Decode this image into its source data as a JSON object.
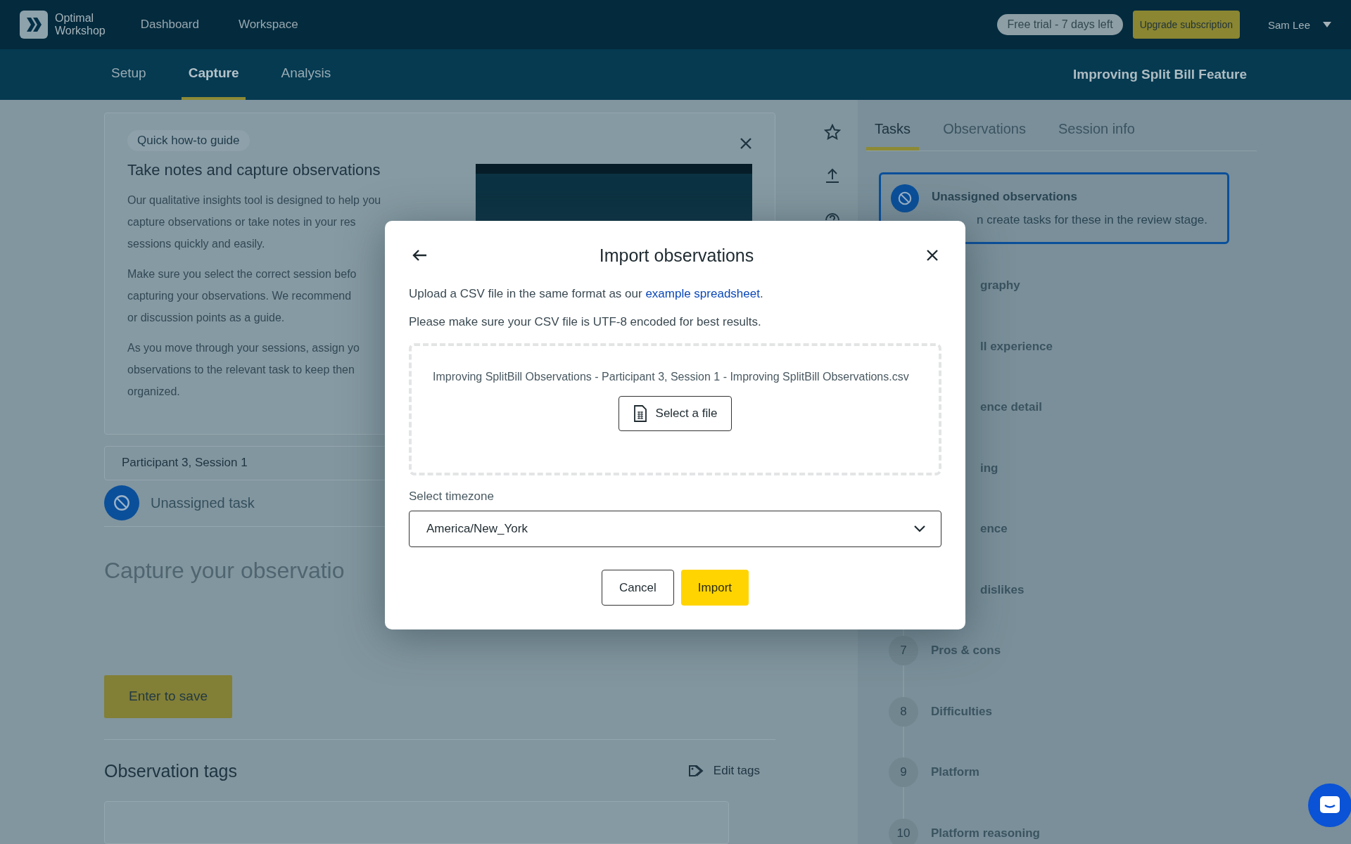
{
  "header": {
    "logo_lines": [
      "Optimal",
      "Workshop"
    ],
    "nav": [
      {
        "label": "Dashboard"
      },
      {
        "label": "Workspace"
      }
    ],
    "trial_badge": "Free trial - 7 days left",
    "upgrade_button": "Upgrade subscription",
    "user": "Sam Lee"
  },
  "subnav": {
    "tabs": [
      {
        "label": "Setup",
        "selected": false
      },
      {
        "label": "Capture",
        "selected": true
      },
      {
        "label": "Analysis",
        "selected": false
      }
    ],
    "study_title": "Improving Split Bill Feature"
  },
  "guide": {
    "badge": "Quick how-to guide",
    "title": "Take notes and capture observations",
    "paragraphs": [
      [
        "Our qualitative insights tool is designed to help you",
        "capture observations or take notes in your res",
        "sessions quickly and easily."
      ],
      [
        "Make sure you select the correct session befo",
        "capturing your observations. We recommend",
        "or discussion points as a guide."
      ],
      [
        "As you move through your sessions, assign yo",
        "observations to the relevant task to keep then",
        "organized."
      ]
    ]
  },
  "session_select": {
    "value": "Participant 3, Session 1"
  },
  "current_task": "Unassigned task",
  "observation_input": {
    "placeholder": "Capture your observatio"
  },
  "save_button": "Enter to save",
  "tags": {
    "title": "Observation tags",
    "edit_link": "Edit tags"
  },
  "side_tabs": [
    {
      "label": "Tasks",
      "selected": true
    },
    {
      "label": "Observations",
      "selected": false
    },
    {
      "label": "Session info",
      "selected": false
    }
  ],
  "unassigned_card": {
    "title": "Unassigned observations",
    "text": "n create tasks for these in the review stage."
  },
  "tasks": [
    {
      "kind": "clipped",
      "label": "graphy"
    },
    {
      "kind": "clipped",
      "label": "ll experience"
    },
    {
      "kind": "clipped",
      "label": "ence detail"
    },
    {
      "kind": "clipped",
      "label": "ing"
    },
    {
      "kind": "clipped",
      "label": "ence"
    },
    {
      "kind": "clipped",
      "label": "dislikes"
    },
    {
      "kind": "numbered",
      "number": "7",
      "label": "Pros & cons"
    },
    {
      "kind": "numbered",
      "number": "8",
      "label": "Difficulties"
    },
    {
      "kind": "numbered",
      "number": "9",
      "label": "Platform"
    },
    {
      "kind": "numbered",
      "number": "10",
      "label": "Platform reasoning"
    }
  ],
  "modal": {
    "title": "Import observations",
    "intro": "Upload a CSV file in the same format as our ",
    "link": "example spreadsheet",
    "intro_end": ".",
    "note": "Please make sure your CSV file is UTF-8 encoded for best results.",
    "file_name": "Improving SplitBill Observations - Participant 3, Session 1 - Improving SplitBill Observations.csv",
    "select_file_button": "Select a file",
    "timezone_label": "Select timezone",
    "timezone": "America/New_York",
    "buttons": [
      {
        "label": "Cancel",
        "kind": "secondary"
      },
      {
        "label": "Import",
        "kind": "primary"
      }
    ]
  }
}
